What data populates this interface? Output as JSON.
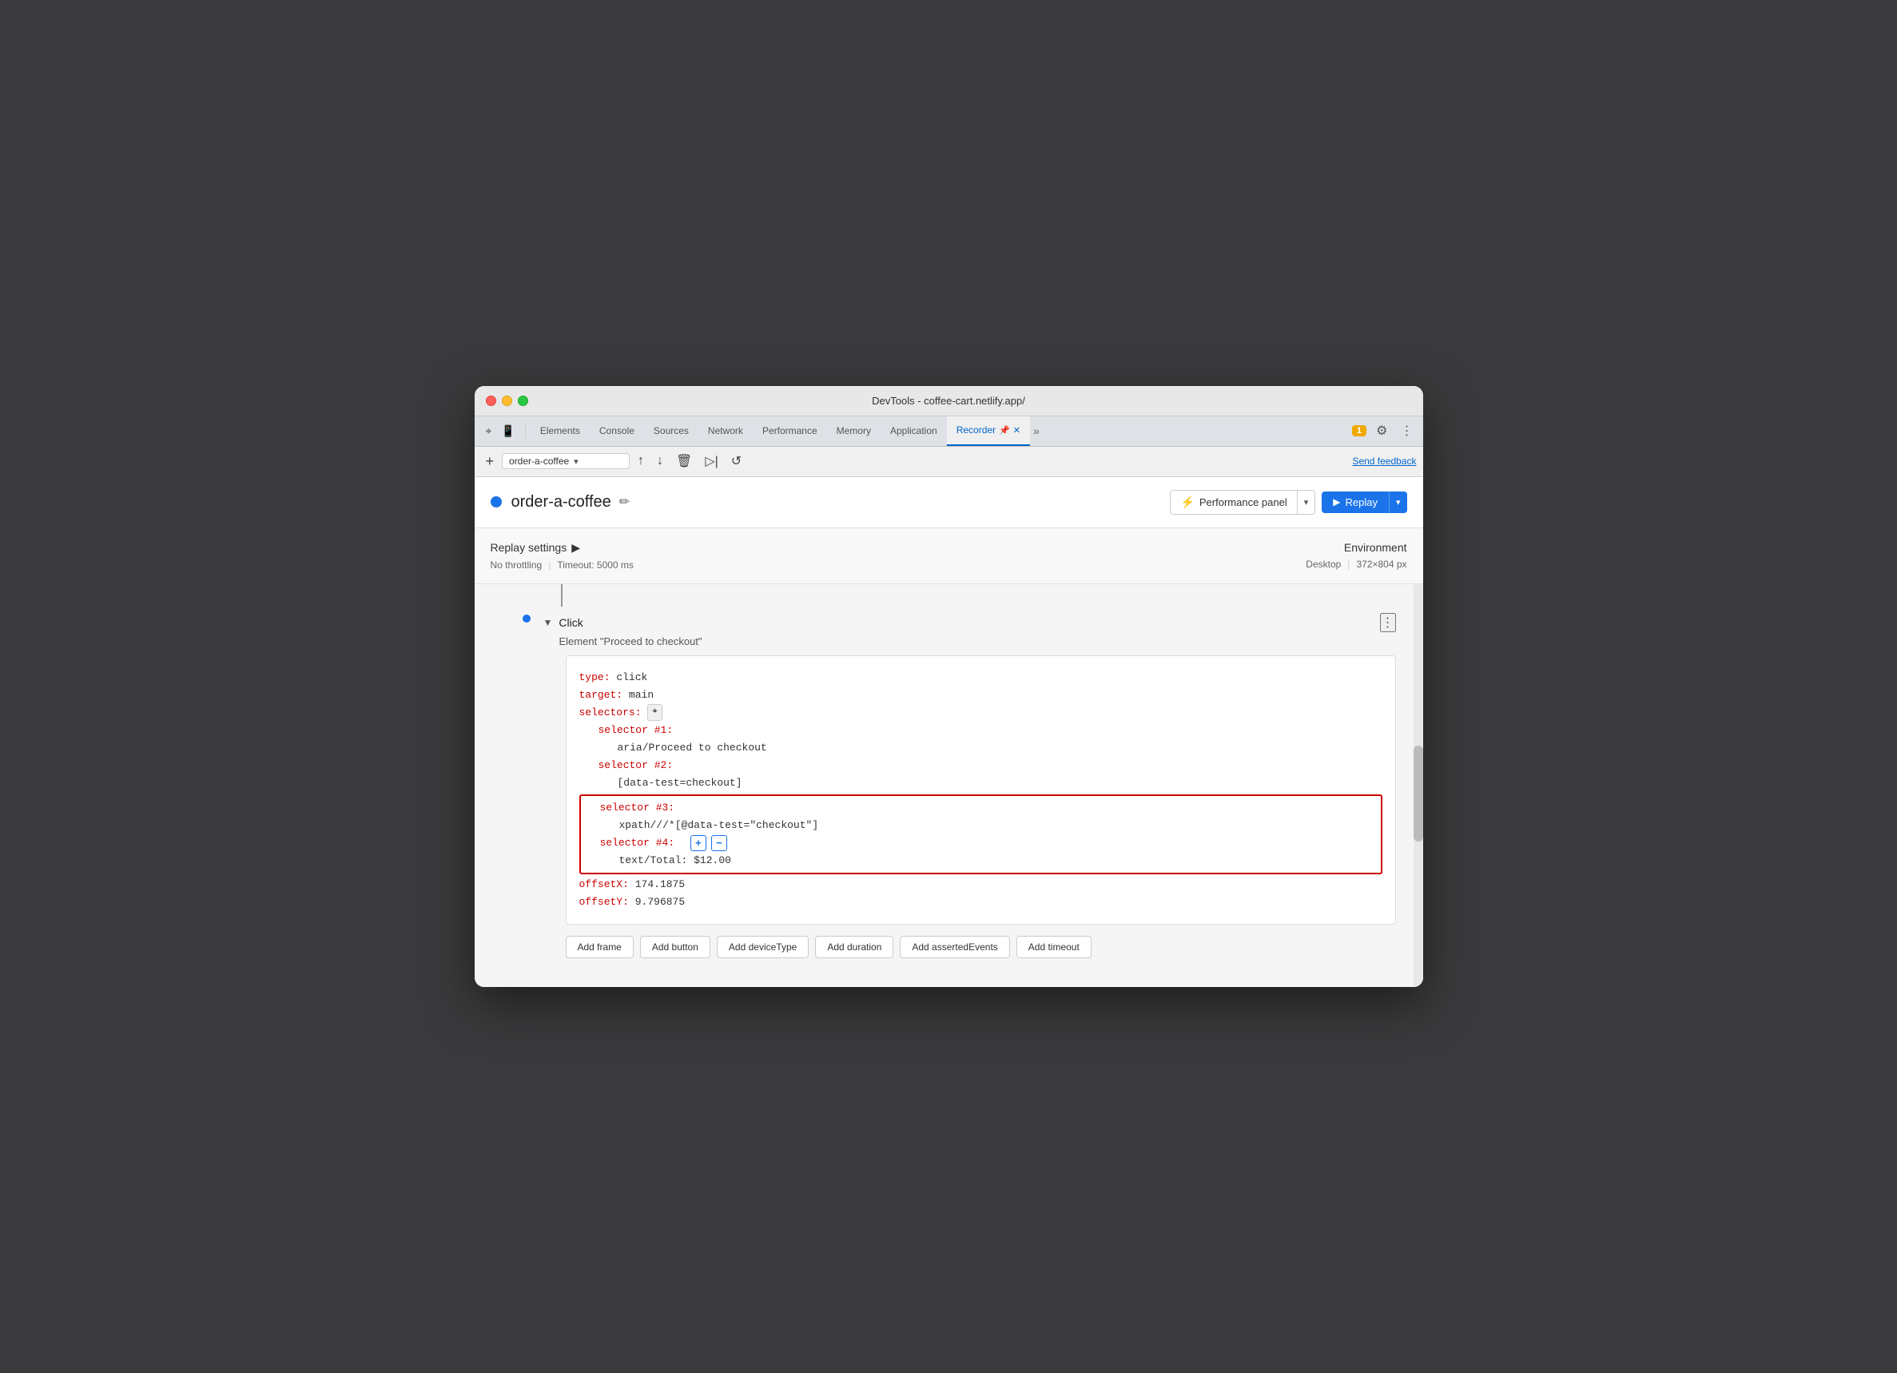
{
  "window": {
    "title": "DevTools - coffee-cart.netlify.app/"
  },
  "tabs": [
    {
      "id": "elements",
      "label": "Elements",
      "active": false
    },
    {
      "id": "console",
      "label": "Console",
      "active": false
    },
    {
      "id": "sources",
      "label": "Sources",
      "active": false
    },
    {
      "id": "network",
      "label": "Network",
      "active": false
    },
    {
      "id": "performance",
      "label": "Performance",
      "active": false
    },
    {
      "id": "memory",
      "label": "Memory",
      "active": false
    },
    {
      "id": "application",
      "label": "Application",
      "active": false
    },
    {
      "id": "recorder",
      "label": "Recorder",
      "active": true
    }
  ],
  "toolbar": {
    "recording_name": "order-a-coffee",
    "send_feedback": "Send feedback"
  },
  "recording": {
    "title": "order-a-coffee",
    "dot_color": "#1a73e8"
  },
  "header_buttons": {
    "perf_panel": "Performance panel",
    "replay": "Replay"
  },
  "replay_settings": {
    "title": "Replay settings",
    "throttling": "No throttling",
    "timeout": "Timeout: 5000 ms"
  },
  "environment": {
    "title": "Environment",
    "type": "Desktop",
    "dimensions": "372×804 px"
  },
  "step": {
    "type": "Click",
    "subtitle": "Element \"Proceed to checkout\"",
    "code": {
      "type_key": "type:",
      "type_val": "click",
      "target_key": "target:",
      "target_val": "main",
      "selectors_key": "selectors:",
      "selector1_key": "selector #1:",
      "selector1_val": "aria/Proceed to checkout",
      "selector2_key": "selector #2:",
      "selector2_val": "[data-test=checkout]",
      "selector3_key": "selector #3:",
      "selector3_val": "xpath///*[@data-test=\"checkout\"]",
      "selector4_key": "selector #4:",
      "selector4_val": "text/Total: $12.00",
      "offsetX_key": "offsetX:",
      "offsetX_val": "174.1875",
      "offsetY_key": "offsetY:",
      "offsetY_val": "9.796875"
    },
    "action_buttons": [
      "Add frame",
      "Add button",
      "Add deviceType",
      "Add duration",
      "Add assertedEvents",
      "Add timeout"
    ]
  },
  "icons": {
    "cursor": "⌖",
    "toggle": "□",
    "plus": "+",
    "chevron_down": "▾",
    "chevron_right": "▸",
    "upload": "↑",
    "download": "↓",
    "delete": "🗑",
    "play_step": "▷",
    "replay_circular": "↺",
    "record_start": "●",
    "more_vert": "⋮",
    "edit": "✏",
    "gear": "⚙",
    "badge_count": "1",
    "selector_icon": "⌖"
  }
}
